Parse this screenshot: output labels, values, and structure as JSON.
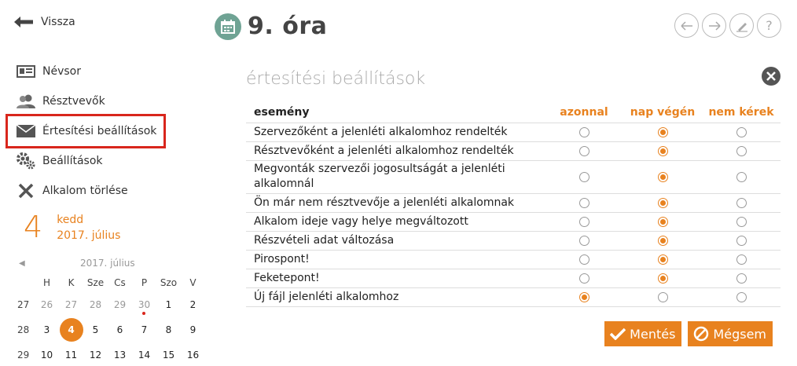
{
  "back_label": "Vissza",
  "page_title": "9. óra",
  "nav": [
    {
      "label": "Névsor",
      "icon": "id-card-icon"
    },
    {
      "label": "Résztvevők",
      "icon": "users-icon"
    },
    {
      "label": "Értesítési beállítások",
      "icon": "envelope-icon"
    },
    {
      "label": "Beállítások",
      "icon": "gears-icon"
    },
    {
      "label": "Alkalom törlése",
      "icon": "x-icon"
    }
  ],
  "date": {
    "day": "4",
    "weekday": "kedd",
    "month_year": "2017. július"
  },
  "calendar": {
    "title": "2017. július",
    "dow": [
      "H",
      "K",
      "Sze",
      "Cs",
      "P",
      "Szo",
      "V"
    ],
    "rows": [
      {
        "week": "27",
        "days": [
          "26",
          "27",
          "28",
          "29",
          "30",
          "1",
          "2"
        ]
      },
      {
        "week": "28",
        "days": [
          "3",
          "4",
          "5",
          "6",
          "7",
          "8",
          "9"
        ]
      },
      {
        "week": "29",
        "days": [
          "10",
          "11",
          "12",
          "13",
          "14",
          "15",
          "16"
        ]
      }
    ]
  },
  "panel": {
    "title": "értesítési beállítások",
    "headers": {
      "event": "esemény",
      "now": "azonnal",
      "end_of_day": "nap végén",
      "none": "nem kérek"
    },
    "rows": [
      {
        "label": "Szervezőként a jelenléti alkalomhoz rendelték",
        "selected": "end_of_day"
      },
      {
        "label": "Résztvevőként a jelenléti alkalomhoz rendelték",
        "selected": "end_of_day"
      },
      {
        "label": "Megvonták szervezői jogosultságát a jelenléti alkalomnál",
        "selected": "end_of_day"
      },
      {
        "label": "Ön már nem résztvevője a jelenléti alkalomnak",
        "selected": "end_of_day"
      },
      {
        "label": "Alkalom ideje vagy helye megváltozott",
        "selected": "end_of_day"
      },
      {
        "label": "Részvételi adat változása",
        "selected": "end_of_day"
      },
      {
        "label": "Pirospont!",
        "selected": "end_of_day"
      },
      {
        "label": "Feketepont!",
        "selected": "end_of_day"
      },
      {
        "label": "Új fájl jelenléti alkalomhoz",
        "selected": "now"
      }
    ],
    "save_label": "Mentés",
    "cancel_label": "Mégsem"
  },
  "colors": {
    "accent": "#e8821f",
    "highlight": "#d9261c",
    "title_icon_bg": "#6fa394"
  }
}
